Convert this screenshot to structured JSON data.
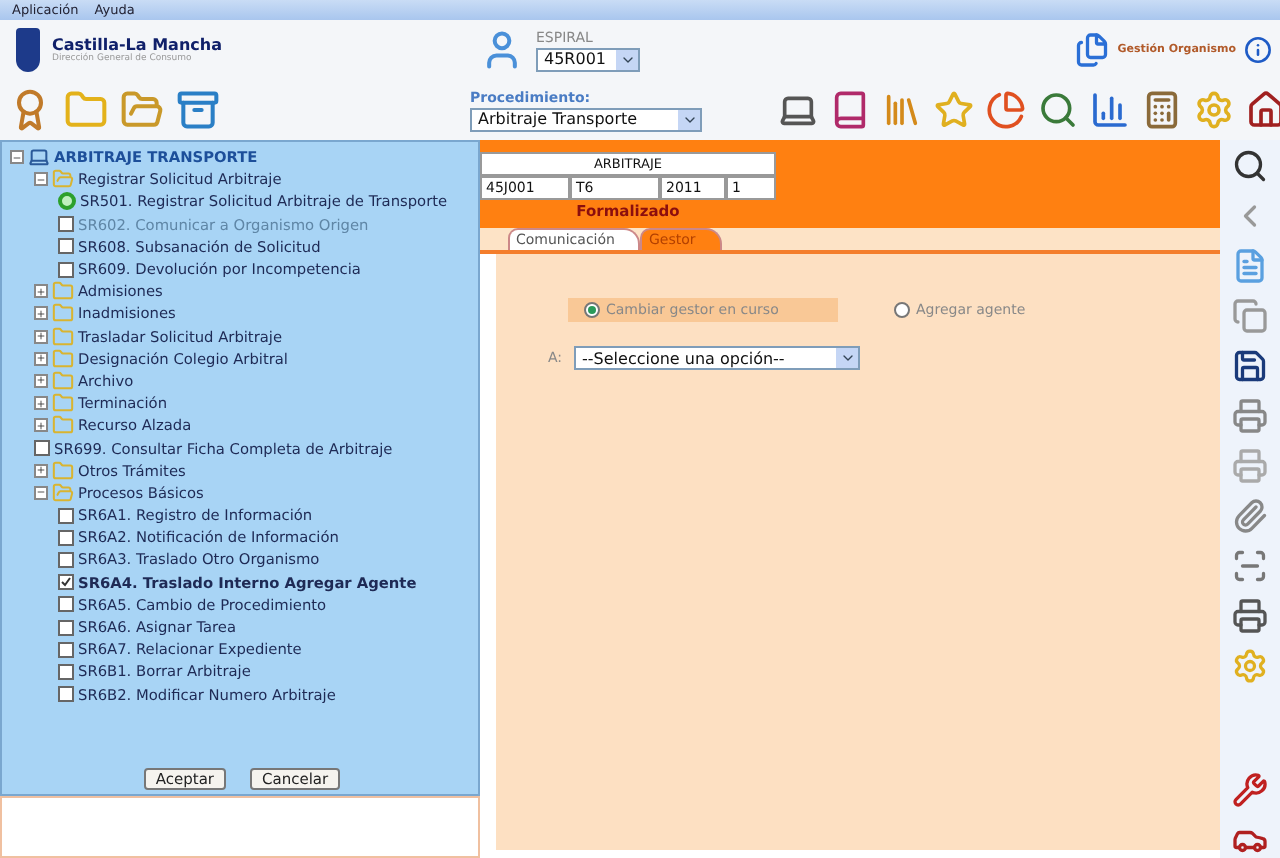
{
  "menu_bar": [
    "Aplicación",
    "Ayuda"
  ],
  "header": {
    "org_name": "Castilla-La Mancha",
    "org_subtitle": "Dirección General de Consumo",
    "user_label": "ESPIRAL",
    "user_select": "45R001",
    "app_title": "Gestión Organismo"
  },
  "toolbar": {
    "procedure_label": "Procedimiento:",
    "procedure_select": "Arbitraje Transporte"
  },
  "tree": {
    "label": "ARBITRAJE TRANSPORTE",
    "expanded": true,
    "children": [
      {
        "kind": "folder",
        "label": "Registrar Solicitud Arbitraje",
        "expanded": true,
        "children": [
          {
            "kind": "current",
            "label": "SR501. Registrar Solicitud Arbitraje de Transporte"
          },
          {
            "kind": "task",
            "label": "SR602. Comunicar a Organismo Origen",
            "checked": false,
            "disabled": true
          },
          {
            "kind": "task",
            "label": "SR608. Subsanación de Solicitud",
            "checked": false,
            "disabled": false
          },
          {
            "kind": "task",
            "label": "SR609. Devolución por Incompetencia",
            "checked": false,
            "disabled": false
          }
        ]
      },
      {
        "kind": "folder",
        "label": "Admisiones",
        "expanded": false
      },
      {
        "kind": "folder",
        "label": "Inadmisiones",
        "expanded": false
      },
      {
        "kind": "folder",
        "label": "Trasladar Solicitud Arbitraje",
        "expanded": false
      },
      {
        "kind": "folder",
        "label": "Designación Colegio Arbitral",
        "expanded": false
      },
      {
        "kind": "folder",
        "label": "Archivo",
        "expanded": false
      },
      {
        "kind": "folder",
        "label": "Terminación",
        "expanded": false
      },
      {
        "kind": "folder",
        "label": "Recurso Alzada",
        "expanded": false
      },
      {
        "kind": "task",
        "label": "SR699. Consultar Ficha Completa de Arbitraje",
        "checked": false,
        "disabled": false
      },
      {
        "kind": "folder",
        "label": "Otros Trámites",
        "expanded": false
      },
      {
        "kind": "folder",
        "label": "Procesos Básicos",
        "expanded": true,
        "children": [
          {
            "kind": "task",
            "label": "SR6A1. Registro de Información",
            "checked": false,
            "disabled": false
          },
          {
            "kind": "task",
            "label": "SR6A2. Notificación de Información",
            "checked": false,
            "disabled": false
          },
          {
            "kind": "task",
            "label": "SR6A3. Traslado Otro Organismo",
            "checked": false,
            "disabled": false
          },
          {
            "kind": "task",
            "label": "SR6A4. Traslado Interno Agregar Agente",
            "checked": true,
            "disabled": false
          },
          {
            "kind": "task",
            "label": "SR6A5. Cambio de Procedimiento",
            "checked": false,
            "disabled": false
          },
          {
            "kind": "task",
            "label": "SR6A6. Asignar Tarea",
            "checked": false,
            "disabled": false
          },
          {
            "kind": "task",
            "label": "SR6A7. Relacionar Expediente",
            "checked": false,
            "disabled": false
          },
          {
            "kind": "task",
            "label": "SR6B1. Borrar Arbitraje",
            "checked": false,
            "disabled": false
          },
          {
            "kind": "task",
            "label": "SR6B2. Modificar Numero Arbitraje",
            "checked": false,
            "disabled": false
          }
        ]
      }
    ]
  },
  "tree_buttons": [
    "Aceptar",
    "Cancelar"
  ],
  "case": {
    "title": "ARBITRAJE",
    "cells": [
      "45J001",
      "T6",
      "2011",
      "1"
    ],
    "status": "Formalizado"
  },
  "tabs": [
    {
      "label": "Comunicación",
      "selected": false
    },
    {
      "label": "Gestor",
      "selected": true
    }
  ],
  "options": [
    {
      "label": "Cambiar gestor en curso",
      "selected": true
    },
    {
      "label": "Agregar agente",
      "selected": false
    }
  ],
  "target": {
    "label": "A:",
    "select": "--Seleccione una opción--"
  }
}
